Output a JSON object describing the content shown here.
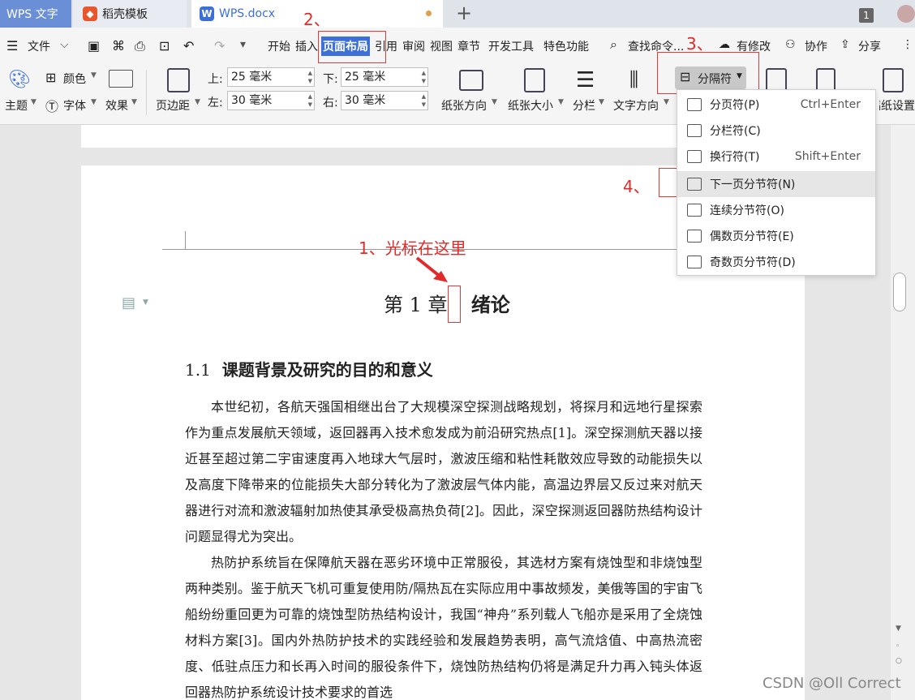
{
  "tabs": {
    "wps": "WPS 文字",
    "daoke": "稻壳模板",
    "doc": "WPS.docx",
    "window_count": "1"
  },
  "menu": {
    "file": "文件",
    "start": "开始",
    "insert": "插入",
    "layout": "页面布局",
    "reference": "引用",
    "review": "审阅",
    "view": "视图",
    "chapter": "章节",
    "dev": "开发工具",
    "special": "特色功能",
    "search": "查找命令...",
    "modified": "有修改",
    "collab": "协作",
    "share": "分享"
  },
  "ribbon": {
    "theme": "主题",
    "color": "颜色",
    "font": "字体",
    "effect": "效果",
    "margin": "页边距",
    "top_label": "上:",
    "bottom_label": "下:",
    "left_label": "左:",
    "right_label": "右:",
    "top_value": "25 毫米",
    "bottom_value": "25 毫米",
    "left_value": "30 毫米",
    "right_value": "30 毫米",
    "orientation": "纸张方向",
    "size": "纸张大小",
    "columns": "分栏",
    "text_direction": "文字方向",
    "separator": "分隔符",
    "page_setup": "稿纸设置"
  },
  "annotations": {
    "step1": "1、光标在这里",
    "step2": "2、",
    "step3": "3、",
    "step4": "4、"
  },
  "dropdown": [
    {
      "label": "分页符(P)",
      "shortcut": "Ctrl+Enter"
    },
    {
      "label": "分栏符(C)",
      "shortcut": ""
    },
    {
      "label": "换行符(T)",
      "shortcut": "Shift+Enter"
    },
    {
      "label": "下一页分节符(N)",
      "shortcut": ""
    },
    {
      "label": "连续分节符(O)",
      "shortcut": ""
    },
    {
      "label": "偶数页分节符(E)",
      "shortcut": ""
    },
    {
      "label": "奇数页分节符(D)",
      "shortcut": ""
    }
  ],
  "document": {
    "chapter_num": "第 1 章",
    "chapter_title": "绪论",
    "heading_num": "1.1",
    "heading_title": "课题背景及研究的目的和意义",
    "para1": "本世纪初，各航天强国相继出台了大规模深空探测战略规划，将探月和远地行星探索作为重点发展航天领域，返回器再入技术愈发成为前沿研究热点[1]。深空探测航天器以接近甚至超过第二宇宙速度再入地球大气层时，激波压缩和粘性耗散效应导致的动能损失以及高度下降带来的位能损失大部分转化为了激波层气体内能，高温边界层又反过来对航天器进行对流和激波辐射加热使其承受极高热负荷[2]。因此，深空探测返回器防热结构设计问题显得尤为突出。",
    "para2": "热防护系统旨在保障航天器在恶劣环境中正常服役，其选材方案有烧蚀型和非烧蚀型两种类别。鉴于航天飞机可重复使用防/隔热瓦在实际应用中事故频发，美俄等国的宇宙飞船纷纷重回更为可靠的烧蚀型防热结构设计，我国“神舟”系列载人飞船亦是采用了全烧蚀材料方案[3]。国内外热防护技术的实践经验和发展趋势表明，高气流焓值、中高热流密度、低驻点压力和长再入时间的服役条件下，烧蚀防热结构仍将是满足升力再入钝头体返回器热防护系统设计技术要求的首选"
  },
  "watermark": "CSDN @Oll Correct"
}
